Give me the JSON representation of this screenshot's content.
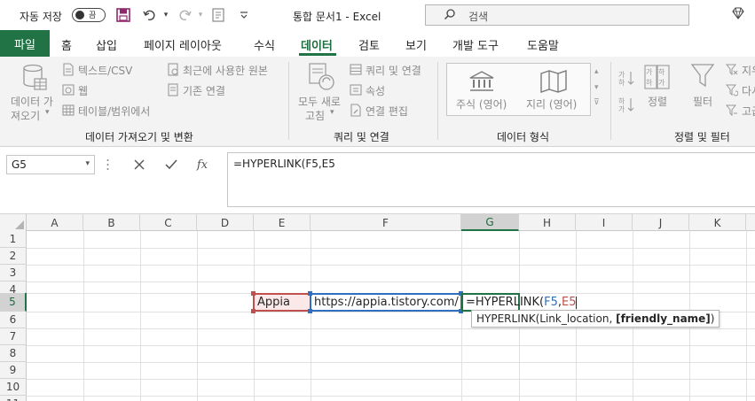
{
  "titlebar": {
    "autosave_label": "자동 저장",
    "toggle_label": "끔",
    "doc_title": "통합 문서1  -  Excel",
    "search_placeholder": "검색",
    "icons": [
      "save-icon",
      "undo-icon",
      "redo-icon",
      "form-icon",
      "customize-qat-icon",
      "search-icon",
      "premium-diamond-icon"
    ]
  },
  "tabs": {
    "file": "파일",
    "items": [
      "홈",
      "삽입",
      "페이지 레이아웃",
      "수식",
      "데이터",
      "검토",
      "보기",
      "개발 도구",
      "도움말"
    ],
    "active": "데이터"
  },
  "ribbon": {
    "get_data": {
      "big_button": [
        "데이터 가",
        "져오기"
      ],
      "items": [
        "텍스트/CSV",
        "웹",
        "테이블/범위에서",
        "최근에 사용한 원본",
        "기존 연결"
      ],
      "group_label": "데이터 가져오기 및 변환"
    },
    "queries": {
      "big_button": [
        "모두 새로",
        "고침"
      ],
      "items": [
        "쿼리 및 연결",
        "속성",
        "연결 편집"
      ],
      "group_label": "쿼리 및 연결"
    },
    "data_types": {
      "items": [
        "주식 (영어)",
        "지리 (영어)"
      ],
      "group_label": "데이터 형식"
    },
    "sort_filter": {
      "sort_label": "정렬",
      "filter_label": "필터",
      "side_items": [
        "지우",
        "다시",
        "고급"
      ],
      "group_label": "정렬 및 필터"
    }
  },
  "formula_bar": {
    "name_box": "G5",
    "cancel_icon": "cancel-x-icon",
    "enter_icon": "check-icon",
    "fx_label": "fx",
    "formula": "=HYPERLINK(F5,E5"
  },
  "grid": {
    "columns": [
      "A",
      "B",
      "C",
      "D",
      "E",
      "F",
      "G",
      "H",
      "I",
      "J",
      "K"
    ],
    "rows": [
      "1",
      "2",
      "3",
      "4",
      "5",
      "6",
      "7",
      "8",
      "9",
      "10",
      "11"
    ],
    "selected_column": "G",
    "selected_row": "5",
    "cells": {
      "E5": "Appia",
      "F5": "https://appia.tistory.com/",
      "G5_prefix": "=HYPERLINK(",
      "G5_ref1": "F5",
      "G5_comma": ",",
      "G5_ref2": "E5"
    },
    "tooltip": {
      "func": "HYPERLINK(Link_location, ",
      "bold_arg": "[friendly_name]",
      "close": ")"
    }
  },
  "colors": {
    "excel_green": "#217346",
    "ref_blue": "#2f6fbf",
    "ref_red": "#c0504d"
  }
}
